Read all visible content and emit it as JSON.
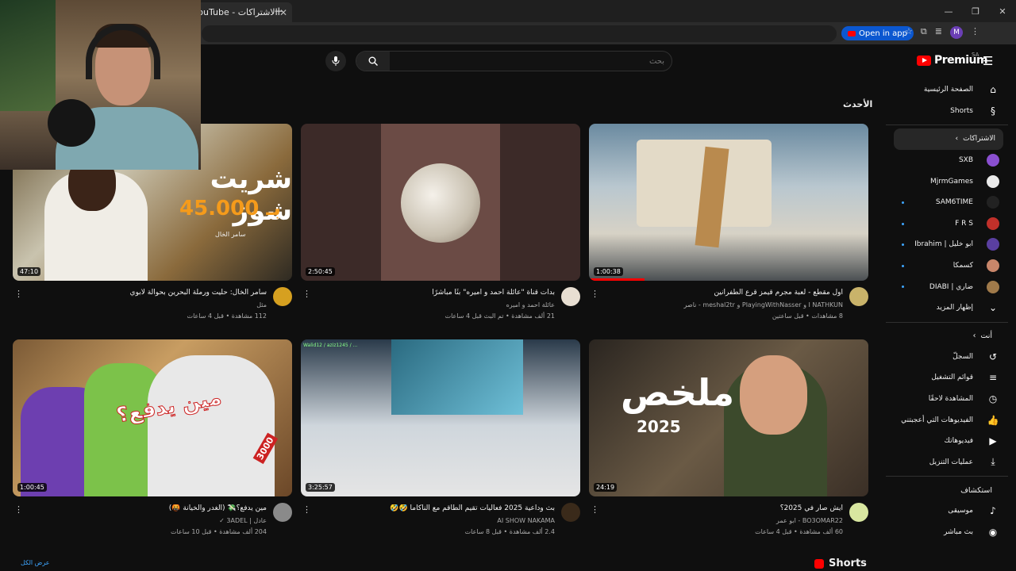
{
  "browser": {
    "tab_title": "YouTube - الاشتراكات",
    "new_tab": "+",
    "open_in_app": "Open in app",
    "profile_initial": "M",
    "window_controls": [
      "—",
      "❐",
      "✕"
    ]
  },
  "header": {
    "logo_text": "Premium",
    "logo_region": "SA",
    "search_placeholder": "بحث",
    "search_value": "▦"
  },
  "sidebar": {
    "main": [
      {
        "label": "الصفحة الرئيسية",
        "icon": "home-icon",
        "glyph": "⌂"
      },
      {
        "label": "Shorts",
        "icon": "shorts-icon",
        "glyph": "§"
      }
    ],
    "subscriptions_heading": "الاشتراكات",
    "channels": [
      {
        "label": "SXB",
        "color": "#8a4fd0",
        "dot": false
      },
      {
        "label": "MjrmGames",
        "color": "#eaeaea",
        "dot": false
      },
      {
        "label": "SAM6TIME",
        "color": "#222",
        "dot": true
      },
      {
        "label": "F R S",
        "color": "#c0302a",
        "dot": true
      },
      {
        "label": "ابو خليل | Ibrahim",
        "color": "#5a3fa0",
        "dot": true
      },
      {
        "label": "كسمكا",
        "color": "#c9866a",
        "dot": true
      },
      {
        "label": "ضاري | DIABI",
        "color": "#a07a4a",
        "dot": true
      }
    ],
    "show_more": "إظهار المزيد",
    "you_heading": "أنت",
    "you_items": [
      {
        "label": "السجلّ",
        "icon": "history-icon",
        "glyph": "↺"
      },
      {
        "label": "قوائم التشغيل",
        "icon": "playlists-icon",
        "glyph": "≡"
      },
      {
        "label": "المشاهدة لاحقًا",
        "icon": "watch-later-icon",
        "glyph": "◷"
      },
      {
        "label": "الفيديوهات التي أعجبتني",
        "icon": "like-icon",
        "glyph": "👍"
      },
      {
        "label": "فيديوهاتك",
        "icon": "your-videos-icon",
        "glyph": "▶"
      },
      {
        "label": "عمليات التنزيل",
        "icon": "download-icon",
        "glyph": "⤓"
      }
    ],
    "explore_heading": "استكشاف",
    "explore_items": [
      {
        "label": "موسيقى",
        "icon": "music-icon",
        "glyph": "♪"
      },
      {
        "label": "بث مباشر",
        "icon": "live-icon",
        "glyph": "◉"
      }
    ]
  },
  "main": {
    "section_title": "الأحدث",
    "shorts_title": "Shorts",
    "show_all": "عرض الكل",
    "videos": [
      {
        "title": "اول مقطع - لعبة مجرم قيمز قرع الطفرانين",
        "channel": "I NATHKUN و PlayingWithNasser و meshal2tr - ناصر",
        "stats": "8 مشاهدات • قبل ساعتين",
        "duration": "1:00:38",
        "avatar": "#c9b36a"
      },
      {
        "title": "بدأت قناة \"عائلة احمد و اميره\" بثًا مباشرًا",
        "channel": "عائلة احمد و اميره",
        "stats": "21 ألف مشاهدة • تم البث قبل 4 ساعات",
        "duration": "2:50:45",
        "avatar": "#e8dfd2"
      },
      {
        "title": "سامر الخال: حليت ورملة البحرين بحوالة لأبوي",
        "channel": "مثل",
        "stats": "112 مشاهدة • قبل 4 ساعات",
        "duration": "47:10",
        "avatar": "#d6a020"
      },
      {
        "title": "ايش صار في 2025؟",
        "channel": "BO3OMAR22 - ابو عمر",
        "stats": "60 ألف مشاهدة • قبل 4 ساعات",
        "duration": "24:19",
        "avatar": "#d8e6a0"
      },
      {
        "title": "بث وداعية 2025 فعاليات تقيم الطاقم مع الناكاما 🤣🤣",
        "channel": "AI SHOW NAKAMA",
        "stats": "2.4 ألف مشاهدة • قبل 8 ساعات",
        "duration": "3:25:57",
        "avatar": "#3a2a1a"
      },
      {
        "title": "مين يدفع؟💸 (الغدر والخيانة 🤬)",
        "channel": "عادل | 3ADEL ✓",
        "stats": "204 ألف مشاهدة • قبل 10 ساعات",
        "duration": "1:00:45",
        "avatar": "#8a8a8a"
      }
    ],
    "thumb_texts": {
      "t1_big": "شريت شوز",
      "t1_price": "بـ 45.000",
      "t1_sign": "سامر الخال",
      "t4_text": "مين يدفع؟",
      "t4_badge": "3000",
      "t5_chat": "Walid12 / aziz1245 / ...",
      "t6_text": "ملخص",
      "t6_year": "2025"
    }
  },
  "colors": {
    "accent": "#ff0000",
    "link": "#3ea6ff",
    "bg": "#0f0f0f"
  }
}
